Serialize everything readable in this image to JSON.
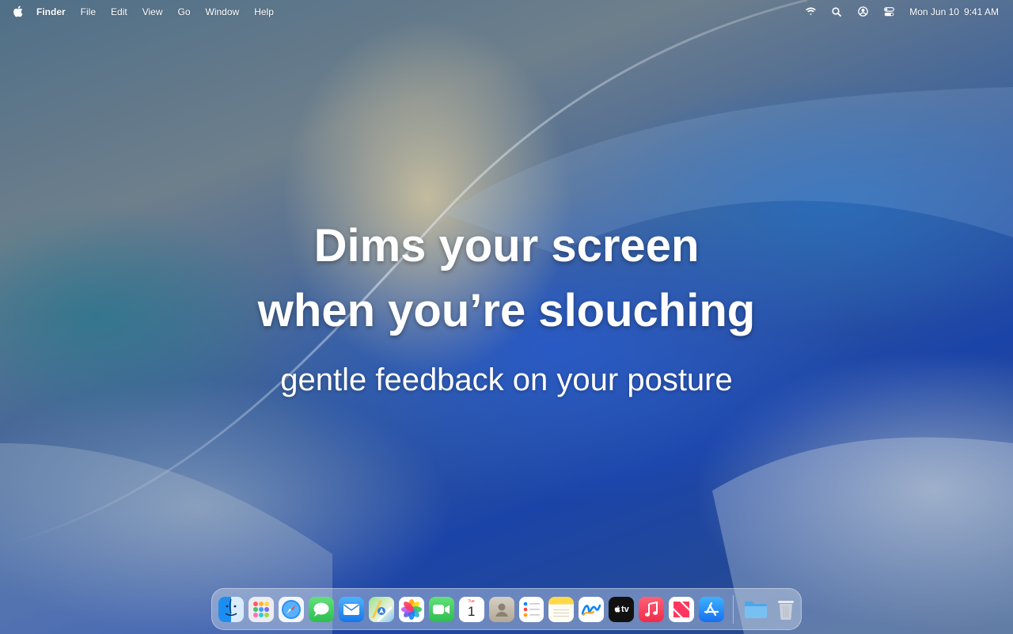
{
  "menubar": {
    "app_name": "Finder",
    "items": [
      "File",
      "Edit",
      "View",
      "Go",
      "Window",
      "Help"
    ],
    "status_icons": [
      "wifi-icon",
      "search-icon",
      "user-icon",
      "control-center-icon"
    ],
    "date": "Mon Jun 10",
    "time": "9:41 AM"
  },
  "hero": {
    "line1": "Dims your screen",
    "line2": "when you’re slouching",
    "subtitle": "gentle feedback on your posture"
  },
  "dock": {
    "apps": [
      {
        "name": "finder-icon",
        "color": "#2a8cf0"
      },
      {
        "name": "launchpad-icon",
        "color": "#e8e8ee"
      },
      {
        "name": "safari-icon",
        "color": "#f4f6fa"
      },
      {
        "name": "messages-icon",
        "color": "#34c759"
      },
      {
        "name": "mail-icon",
        "color": "#1e8cf5"
      },
      {
        "name": "maps-icon",
        "color": "#7ed37a"
      },
      {
        "name": "photos-icon",
        "color": "#ffffff"
      },
      {
        "name": "facetime-icon",
        "color": "#34c759"
      },
      {
        "name": "calendar-icon",
        "color": "#ffffff"
      },
      {
        "name": "contacts-icon",
        "color": "#bfb6a8"
      },
      {
        "name": "reminders-icon",
        "color": "#ffffff"
      },
      {
        "name": "notes-icon",
        "color": "#ffd84a"
      },
      {
        "name": "freeform-icon",
        "color": "#ffffff"
      },
      {
        "name": "apple-tv-icon",
        "color": "#111111"
      },
      {
        "name": "music-icon",
        "color": "#fa3b55"
      },
      {
        "name": "news-icon",
        "color": "#ffffff"
      },
      {
        "name": "app-store-icon",
        "color": "#1f8cf5"
      }
    ],
    "calendar": {
      "day": "Tue",
      "date": "1"
    },
    "tv_label": "tv",
    "folder": {
      "name": "folder-icon",
      "color": "#6fb6ee"
    },
    "trash": {
      "name": "trash-icon"
    }
  }
}
